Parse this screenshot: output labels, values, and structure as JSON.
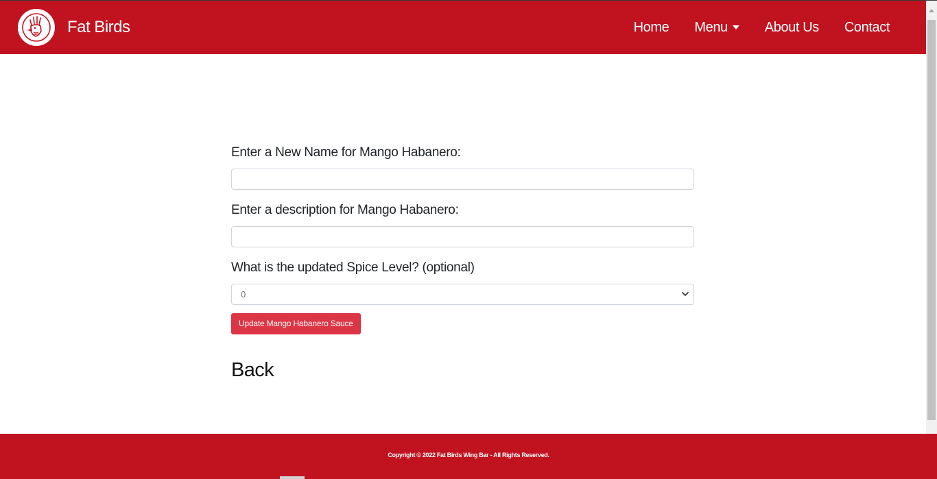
{
  "header": {
    "brand_name": "Fat Birds",
    "logo_icon": "rooster-icon",
    "nav": [
      {
        "label": "Home"
      },
      {
        "label": "Menu"
      },
      {
        "label": "About Us"
      },
      {
        "label": "Contact"
      }
    ]
  },
  "form": {
    "name_label": "Enter a New Name for Mango Habanero:",
    "name_value": "",
    "description_label": "Enter a description for Mango Habanero:",
    "description_value": "",
    "spice_label": "What is the updated Spice Level? (optional)",
    "spice_selected": "0",
    "submit_label": "Update Mango Habanero Sauce"
  },
  "back_label": "Back",
  "footer": {
    "copyright": "Copyright © 2022 Fat Birds Wing Bar - All Rights Reserved."
  },
  "colors": {
    "brand_red": "#c1121f",
    "button_red": "#dc3545"
  }
}
